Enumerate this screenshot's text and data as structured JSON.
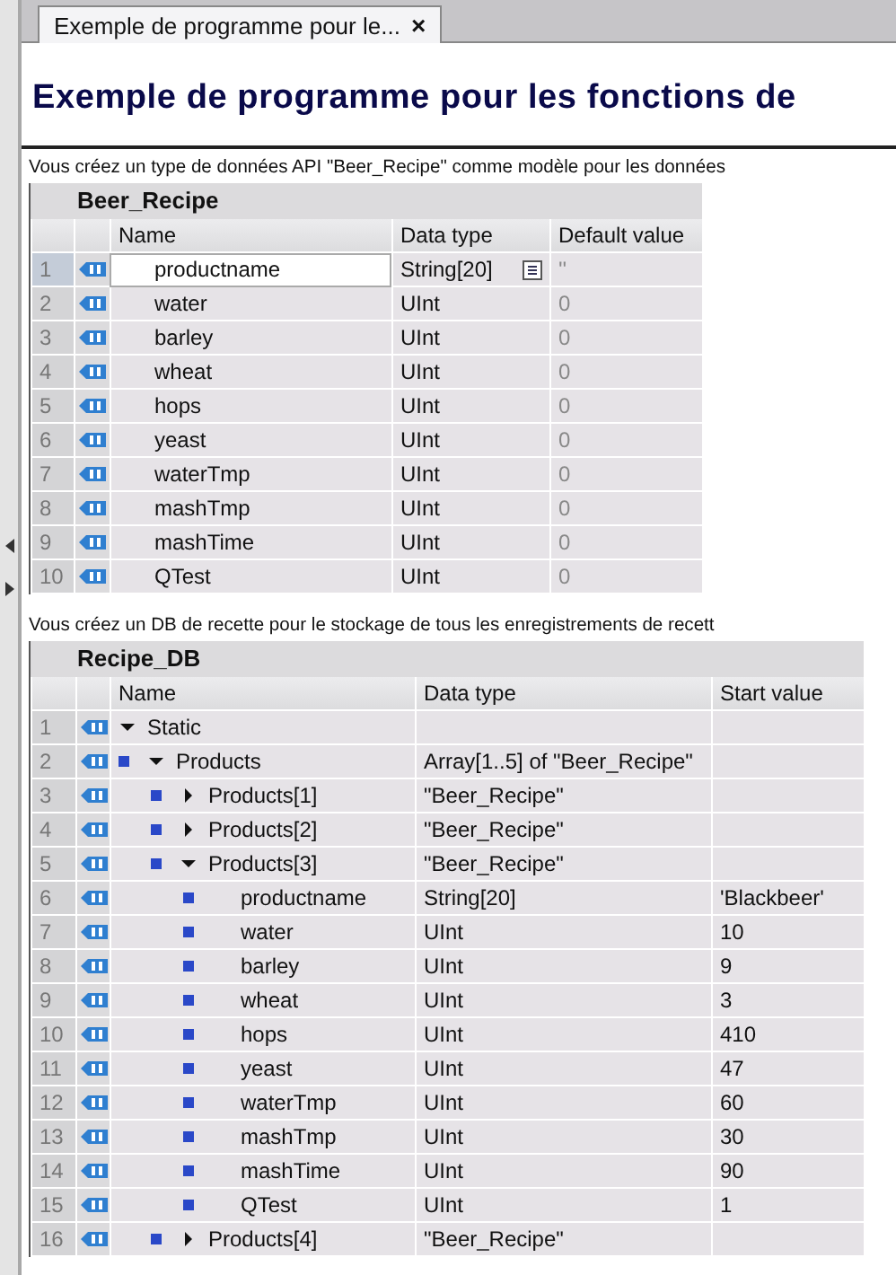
{
  "tab": {
    "title": "Exemple de programme pour le...",
    "close": "×",
    "selected": true
  },
  "heading": "Exemple de programme pour les fonctions de",
  "intro_1": "Vous créez un type de données API \"Beer_Recipe\" comme modèle pour les données",
  "type_table": {
    "title": "Beer_Recipe",
    "columns": [
      "Name",
      "Data type",
      "Default value"
    ],
    "rows": [
      {
        "number": "1",
        "name": "productname",
        "data_type": "String[20]",
        "default_value": "''",
        "selected": true
      },
      {
        "number": "2",
        "name": "water",
        "data_type": "UInt",
        "default_value": "0",
        "selected": false
      },
      {
        "number": "3",
        "name": "barley",
        "data_type": "UInt",
        "default_value": "0",
        "selected": false
      },
      {
        "number": "4",
        "name": "wheat",
        "data_type": "UInt",
        "default_value": "0",
        "selected": false
      },
      {
        "number": "5",
        "name": "hops",
        "data_type": "UInt",
        "default_value": "0",
        "selected": false
      },
      {
        "number": "6",
        "name": "yeast",
        "data_type": "UInt",
        "default_value": "0",
        "selected": false
      },
      {
        "number": "7",
        "name": "waterTmp",
        "data_type": "UInt",
        "default_value": "0",
        "selected": false
      },
      {
        "number": "8",
        "name": "mashTmp",
        "data_type": "UInt",
        "default_value": "0",
        "selected": false
      },
      {
        "number": "9",
        "name": "mashTime",
        "data_type": "UInt",
        "default_value": "0",
        "selected": false
      },
      {
        "number": "10",
        "name": "QTest",
        "data_type": "UInt",
        "default_value": "0",
        "selected": false
      }
    ]
  },
  "intro_2": "Vous créez un DB de recette pour le stockage de tous les enregistrements de recett",
  "db_table": {
    "title": "Recipe_DB",
    "columns": [
      "Name",
      "Data type",
      "Start value"
    ],
    "rows": [
      {
        "number": "1",
        "name": "Static",
        "expanded": true,
        "children": [
          {
            "number": "2",
            "name": "Products",
            "data_type": "Array[1..5] of \"Beer_Recipe\"",
            "expanded": true,
            "children": [
              {
                "number": "3",
                "name": "Products[1]",
                "data_type": "\"Beer_Recipe\"",
                "expanded": false
              },
              {
                "number": "4",
                "name": "Products[2]",
                "data_type": "\"Beer_Recipe\"",
                "expanded": false
              },
              {
                "number": "5",
                "name": "Products[3]",
                "data_type": "\"Beer_Recipe\"",
                "expanded": true,
                "children": [
                  {
                    "number": "6",
                    "name": "productname",
                    "data_type": "String[20]",
                    "start_value": "'Blackbeer'"
                  },
                  {
                    "number": "7",
                    "name": "water",
                    "data_type": "UInt",
                    "start_value": "10"
                  },
                  {
                    "number": "8",
                    "name": "barley",
                    "data_type": "UInt",
                    "start_value": "9"
                  },
                  {
                    "number": "9",
                    "name": "wheat",
                    "data_type": "UInt",
                    "start_value": "3"
                  },
                  {
                    "number": "10",
                    "name": "hops",
                    "data_type": "UInt",
                    "start_value": "410"
                  },
                  {
                    "number": "11",
                    "name": "yeast",
                    "data_type": "UInt",
                    "start_value": "47"
                  },
                  {
                    "number": "12",
                    "name": "waterTmp",
                    "data_type": "UInt",
                    "start_value": "60"
                  },
                  {
                    "number": "13",
                    "name": "mashTmp",
                    "data_type": "UInt",
                    "start_value": "30"
                  },
                  {
                    "number": "14",
                    "name": "mashTime",
                    "data_type": "UInt",
                    "start_value": "90"
                  },
                  {
                    "number": "15",
                    "name": "QTest",
                    "data_type": "UInt",
                    "start_value": "1"
                  }
                ]
              },
              {
                "number": "16",
                "name": "Products[4]",
                "data_type": "\"Beer_Recipe\"",
                "expanded": false
              }
            ]
          }
        ]
      }
    ]
  }
}
